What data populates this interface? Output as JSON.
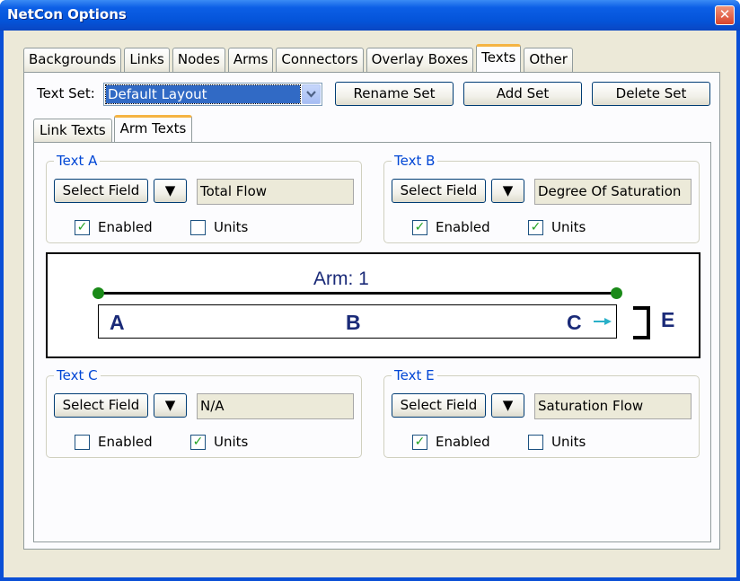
{
  "window": {
    "title": "NetCon Options",
    "close_label": "✕"
  },
  "tabs": [
    "Backgrounds",
    "Links",
    "Nodes",
    "Arms",
    "Connectors",
    "Overlay Boxes",
    "Texts",
    "Other"
  ],
  "active_tab": "Texts",
  "text_set": {
    "label": "Text Set:",
    "value": "Default Layout",
    "rename_label": "Rename Set",
    "add_label": "Add Set",
    "delete_label": "Delete Set"
  },
  "subtabs": [
    "Link Texts",
    "Arm Texts"
  ],
  "active_subtab": "Arm Texts",
  "common": {
    "select_field": "Select Field",
    "dropdown_arrow": "▼",
    "enabled_label": "Enabled",
    "units_label": "Units",
    "check_mark": "✓"
  },
  "groups": {
    "text_a": {
      "title": "Text A",
      "field": "Total Flow",
      "enabled": true,
      "units": false
    },
    "text_b": {
      "title": "Text B",
      "field": "Degree Of Saturation",
      "enabled": true,
      "units": true
    },
    "text_c": {
      "title": "Text C",
      "field": "N/A",
      "enabled": false,
      "units": true
    },
    "text_e": {
      "title": "Text E",
      "field": "Saturation Flow",
      "enabled": true,
      "units": false
    }
  },
  "preview": {
    "arm_label": "Arm: 1",
    "letter_a": "A",
    "letter_b": "B",
    "letter_c": "C",
    "letter_e": "E",
    "arm_color": "#1a2a78",
    "node_color": "#1a8a18",
    "arrow_color": "#2ab0c8"
  }
}
